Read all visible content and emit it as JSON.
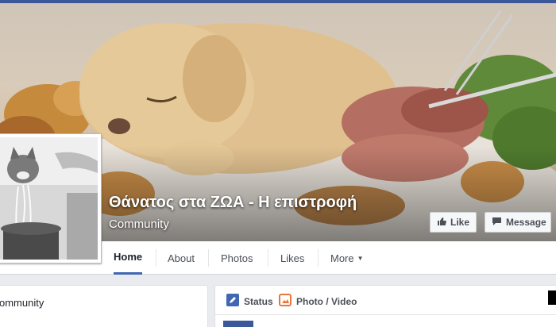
{
  "page": {
    "name": "Θάνατος στα ΖΩΑ - Η επιστροφή",
    "category": "Community"
  },
  "cover_buttons": {
    "like_label": "Like",
    "message_label": "Message"
  },
  "nav": {
    "tabs": [
      {
        "label": "Home",
        "active": true
      },
      {
        "label": "About"
      },
      {
        "label": "Photos"
      },
      {
        "label": "Likes"
      },
      {
        "label": "More"
      }
    ]
  },
  "left_card": {
    "text": "ommunity"
  },
  "composer": {
    "status_label": "Status",
    "photo_video_label": "Photo / Video"
  },
  "icons": {
    "like": "thumbs-up-icon",
    "message": "message-icon",
    "status": "pencil-icon",
    "photo": "photo-icon",
    "more": "caret-down-icon"
  },
  "colors": {
    "brand": "#3b5998",
    "active_tab": "#4267b2"
  }
}
